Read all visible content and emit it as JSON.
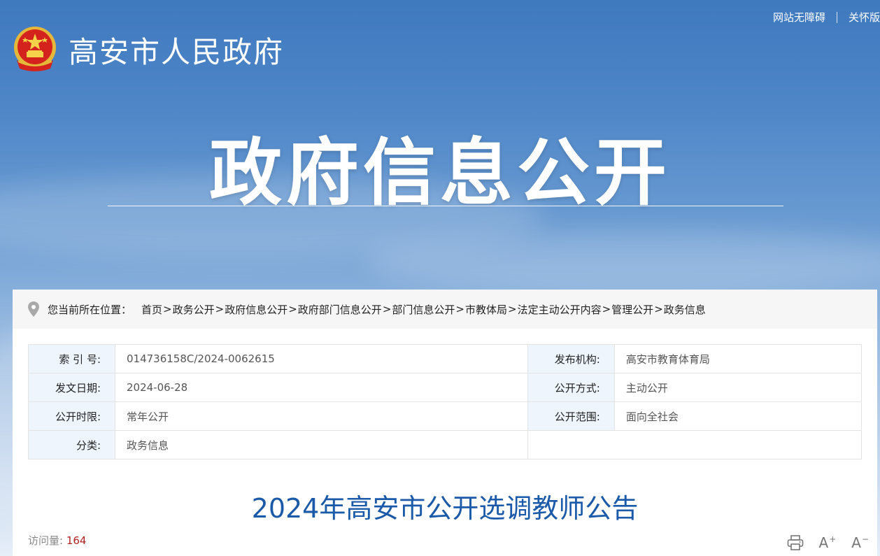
{
  "header": {
    "site_name": "高安市人民政府",
    "accessibility_link": "网站无障碍",
    "elder_link": "关怀版",
    "banner_title": "政府信息公开"
  },
  "breadcrumb": {
    "label": "您当前所在位置：",
    "items": [
      "首页",
      "政务公开",
      "政府信息公开",
      "政府部门信息公开",
      "部门信息公开",
      "市教体局",
      "法定主动公开内容",
      "管理公开",
      "政务信息"
    ],
    "separator": ">"
  },
  "info": {
    "index_label": "索 引 号:",
    "index_value": "014736158C/2024-0062615",
    "publisher_label": "发布机构:",
    "publisher_value": "高安市教育体育局",
    "date_label": "发文日期:",
    "date_value": "2024-06-28",
    "method_label": "公开方式:",
    "method_value": "主动公开",
    "period_label": "公开时限:",
    "period_value": "常年公开",
    "scope_label": "公开范围:",
    "scope_value": "面向全社会",
    "category_label": "分类:",
    "category_value": "政务信息"
  },
  "article": {
    "title": "2024年高安市公开选调教师公告",
    "views_label": "访问量:",
    "views_count": "164"
  },
  "tools": {
    "print_icon": "printer-icon",
    "font_increase": "A",
    "font_increase_sign": "+",
    "font_decrease": "A",
    "font_decrease_sign": "−"
  },
  "colors": {
    "title_blue": "#1a5aa8",
    "label_bg": "#eef5fd",
    "views_red": "#b22222"
  }
}
